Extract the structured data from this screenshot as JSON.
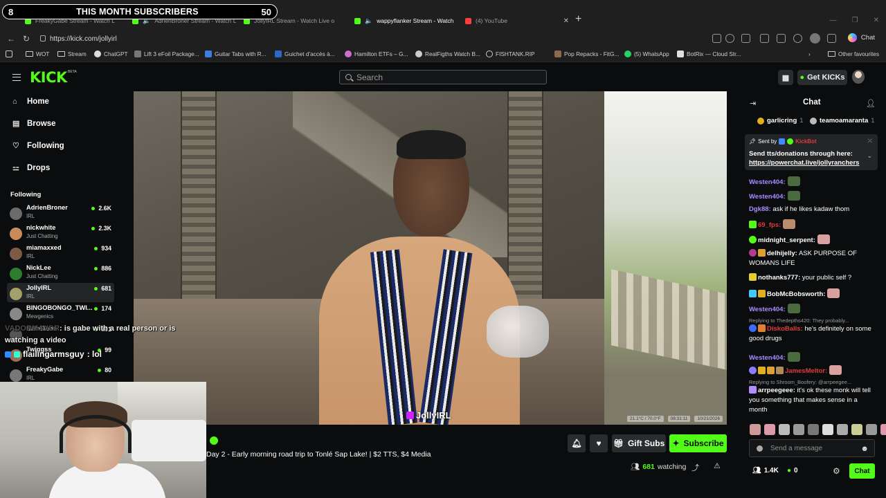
{
  "overlay": {
    "subs_count_left": "8",
    "subs_title": "THIS MONTH SUBSCRIBERS",
    "subs_count_right": "50"
  },
  "browser": {
    "tabs": [
      {
        "title": "FreakyGabe Stream - Watch Live o"
      },
      {
        "title": "AdrienBroner Stream - Watch Li"
      },
      {
        "title": "JollyIRL Stream - Watch Live o"
      },
      {
        "title": "wappyflanker Stream - Watch"
      },
      {
        "title": "(4) YouTube"
      }
    ],
    "url": "https://kick.com/jollyirl",
    "chat_label": "Chat",
    "bookmarks": [
      {
        "label": "WOT"
      },
      {
        "label": "Stream"
      },
      {
        "label": "ChatGPT"
      },
      {
        "label": "Lift 3 eFoil Package..."
      },
      {
        "label": "Guitar Tabs with R..."
      },
      {
        "label": "Guichet d'accès à..."
      },
      {
        "label": "Hamilton ETFs – G..."
      },
      {
        "label": "RealFigths Watch B..."
      },
      {
        "label": "FISHTANK.RIP"
      },
      {
        "label": "Pop Repacks - FitG..."
      },
      {
        "label": "(5) WhatsApp"
      },
      {
        "label": "BotRix — Cloud Str..."
      }
    ],
    "other_favourites": "Other favourites"
  },
  "kick": {
    "logo": "KICK",
    "beta": "BETA",
    "search_placeholder": "Search",
    "get_kicks": "Get KICKs"
  },
  "sidebar": {
    "nav": [
      {
        "label": "Home",
        "icon": "home-icon"
      },
      {
        "label": "Browse",
        "icon": "browse-icon"
      },
      {
        "label": "Following",
        "icon": "heart-icon"
      },
      {
        "label": "Drops",
        "icon": "drops-icon"
      }
    ],
    "following_title": "Following",
    "following": [
      {
        "name": "AdrienBroner",
        "category": "IRL",
        "viewers": "2.6K",
        "color": "#6b6b6b"
      },
      {
        "name": "nickwhite",
        "category": "Just Chatting",
        "viewers": "2.3K",
        "color": "#c98b5a"
      },
      {
        "name": "miamaxxed",
        "category": "IRL",
        "viewers": "934",
        "color": "#7c5a45"
      },
      {
        "name": "NickLee",
        "category": "Just Chatting",
        "viewers": "886",
        "color": "#53fc18"
      },
      {
        "name": "JollyIRL",
        "category": "IRL",
        "viewers": "681",
        "color": "#a3a06a"
      },
      {
        "name": "BINGOBONGO_TWI...",
        "category": "Mewgenics",
        "viewers": "174",
        "color": "#888"
      },
      {
        "name": "SaintTenn",
        "category": "",
        "viewers": "101",
        "color": "#555"
      },
      {
        "name": "Twiggss",
        "category": "",
        "viewers": "99",
        "color": "#9a6b5a"
      },
      {
        "name": "FreakyGabe",
        "category": "IRL",
        "viewers": "80",
        "color": "#777"
      }
    ]
  },
  "overlay_chat": {
    "user1": "VADORMAVOR",
    "msg1": ": is gabe with a real person or is watching a video",
    "user2": "flailingarmsguy",
    "msg2": ": lol"
  },
  "stream": {
    "title": "Day 2 - Early morning road trip to Tonlé Sap Lake! | $2 TTS, $4 Media",
    "watermark": "JollyIRL",
    "stamp": [
      "21.1°C / 70.0°F",
      "08:31:11",
      "10/21/2026"
    ],
    "gift_subs": "Gift Subs",
    "subscribe": "Subscribe",
    "watching_count": "681",
    "watching_label": "watching"
  },
  "chat": {
    "title": "Chat",
    "tippers": [
      {
        "name": "garlicring",
        "count": "1"
      },
      {
        "name": "teamoamaranta",
        "count": "1"
      }
    ],
    "pinned": {
      "sent_by": "Sent by",
      "sender": "KickBot",
      "message": "Send tts/donations through here:",
      "link": "https://powerchat.live/jollyranchers"
    },
    "messages": [
      {
        "reply": "",
        "user": "Westen404:",
        "color": "#a98cff",
        "text": "",
        "emote": "#4a6b3d",
        "badges": []
      },
      {
        "reply": "",
        "user": "Westen404:",
        "color": "#a98cff",
        "text": "",
        "emote": "#4a6b3d",
        "badges": []
      },
      {
        "reply": "",
        "user": "Dgk88:",
        "color": "#a98cff",
        "text": "ask if he likes kadaw thom",
        "emote": "",
        "badges": []
      },
      {
        "reply": "",
        "user": "69_fps:",
        "color": "#e03b3b",
        "text": "",
        "emote": "#b98c6b",
        "badges": [
          "#53fc18"
        ]
      },
      {
        "reply": "",
        "user": "midnight_serpent:",
        "color": "#ffffff",
        "text": "",
        "emote": "#d9a0a0",
        "badges": [
          "#53fc18"
        ]
      },
      {
        "reply": "",
        "user": "delhijelly:",
        "color": "#ffffff",
        "text": "ASK PURPOSE OF WOMANS LIFE",
        "emote": "",
        "badges": [
          "#b23b8a",
          "#e0a030"
        ]
      },
      {
        "reply": "",
        "user": "nothanks777:",
        "color": "#ffffff",
        "text": "your public self ?",
        "emote": "",
        "badges": [
          "#e0d030"
        ]
      },
      {
        "reply": "",
        "user": "BobMcBobsworth:",
        "color": "#ffffff",
        "text": "",
        "emote": "#d9a0a0",
        "badges": [
          "#3ecbff",
          "#e0b020"
        ]
      },
      {
        "reply": "",
        "user": "Westen404:",
        "color": "#a98cff",
        "text": "",
        "emote": "#4a6b3d",
        "badges": []
      },
      {
        "reply": "Replying to Thedepths420: They probably...",
        "user": "DiskoBalls:",
        "color": "#e03b3b",
        "text": "he's definitely on some good drugs",
        "emote": "",
        "badges": [
          "#3e6bff",
          "#e08030"
        ]
      },
      {
        "reply": "",
        "user": "Westen404:",
        "color": "#a98cff",
        "text": "",
        "emote": "#4a6b3d",
        "badges": []
      },
      {
        "reply": "",
        "user": "JamesMeltor:",
        "color": "#e03b3b",
        "text": "",
        "emote": "#d9a0a0",
        "badges": [
          "#8a7cff",
          "#e0b020",
          "#e0a030",
          "#b08b5a"
        ]
      },
      {
        "reply": "Replying to Shroom_Boofery: @arrpeegee...",
        "user": "arrpeegeee:",
        "color": "#ffffff",
        "text": "it's ok these monk will tell you something that makes sense in a month",
        "emote": "",
        "badges": [
          "#b38cff"
        ]
      }
    ],
    "emote_colors": [
      "#c99",
      "#d9a",
      "#bbb",
      "#999",
      "#777",
      "#ddd",
      "#aaa",
      "#cc9",
      "#999",
      "#d9a",
      "#bbb"
    ],
    "input_placeholder": "Send a message",
    "followers": "1.4K",
    "kicks": "0",
    "send": "Chat"
  }
}
